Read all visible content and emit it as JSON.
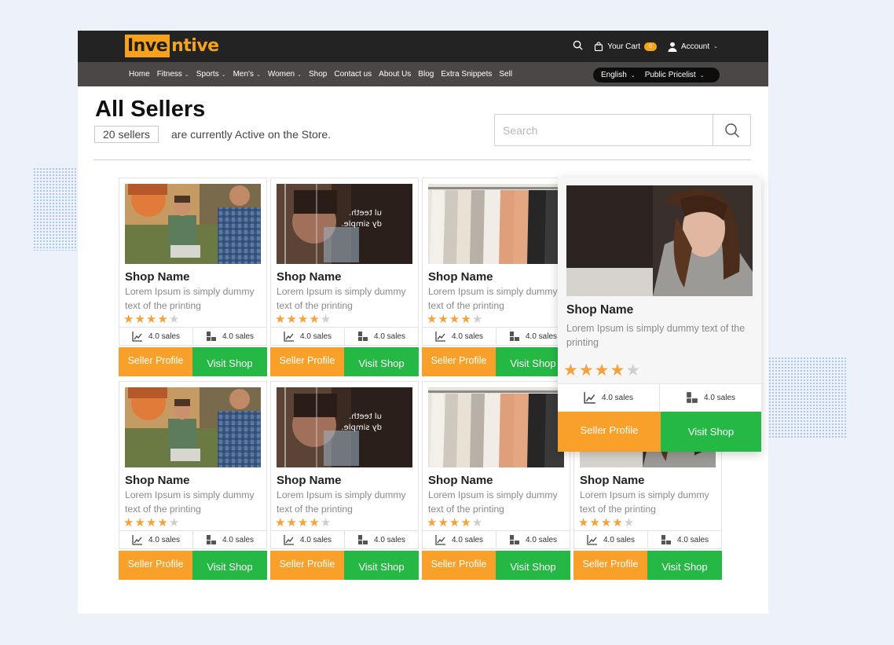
{
  "brand": {
    "logo_part1": "Inve",
    "logo_part2": "ntive"
  },
  "header": {
    "cart_label": "Your Cart",
    "cart_count": "0",
    "account_label": "Account"
  },
  "nav": {
    "items": [
      {
        "label": "Home",
        "dropdown": false
      },
      {
        "label": "Fitness",
        "dropdown": true
      },
      {
        "label": "Sports",
        "dropdown": true
      },
      {
        "label": "Men's",
        "dropdown": true
      },
      {
        "label": "Women",
        "dropdown": true
      },
      {
        "label": "Shop",
        "dropdown": false
      },
      {
        "label": "Contact us",
        "dropdown": false
      },
      {
        "label": "About Us",
        "dropdown": false
      },
      {
        "label": "Blog",
        "dropdown": false
      },
      {
        "label": "Extra Snippets",
        "dropdown": false
      },
      {
        "label": "Sell",
        "dropdown": false
      }
    ],
    "language": "English",
    "pricelist": "Public Pricelist"
  },
  "main": {
    "title": "All Sellers",
    "seller_count": "20 sellers",
    "active_text": "are currently Active on the Store.",
    "search_placeholder": "Search"
  },
  "card_template": {
    "shop_name": "Shop Name",
    "description": "Lorem Ipsum is simply dummy text of the printing",
    "rating": 4,
    "max_rating": 5,
    "sales_1": "4.0 sales",
    "sales_2": "4.0 sales",
    "seller_profile_label": "Seller Profile",
    "visit_shop_label": "Visit Shop"
  },
  "cards": [
    {
      "image": "men-laptop-photo"
    },
    {
      "image": "woman-glass-photo"
    },
    {
      "image": "clothes-rack-photo"
    },
    {
      "image": "men-laptop-photo"
    },
    {
      "image": "woman-glass-photo"
    },
    {
      "image": "clothes-rack-photo"
    },
    {
      "image": "woman-portrait-photo"
    }
  ],
  "featured": {
    "image": "woman-portrait-photo",
    "shop_name": "Shop Name",
    "description": "Lorem Ipsum is simply dummy text of the printing",
    "rating": 4,
    "sales_1": "4.0 sales",
    "sales_2": "4.0 sales",
    "seller_profile_label": "Seller Profile",
    "visit_shop_label": "Visit Shop"
  },
  "colors": {
    "accent_orange": "#f8a02a",
    "accent_green": "#26b845",
    "topbar": "#232323",
    "navbar": "#4b4747",
    "star": "#f6a13a"
  }
}
